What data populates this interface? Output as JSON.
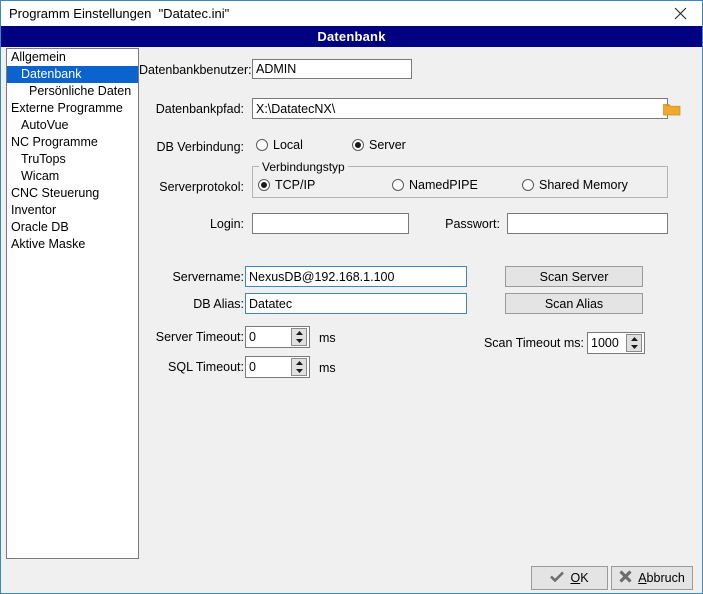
{
  "window": {
    "title": "Programm Einstellungen  \"Datatec.ini\"",
    "close_icon": "close-icon",
    "header_title": "Datenbank",
    "accent_blue": "#000080",
    "selection_blue": "#0b63ce",
    "border_blue": "#3b87c0",
    "folder_icon_color": "#f0a92e"
  },
  "sidebar": {
    "items": [
      {
        "label": "Allgemein",
        "level": 0,
        "selected": false
      },
      {
        "label": "Datenbank",
        "level": 1,
        "selected": true
      },
      {
        "label": "Persönliche Daten",
        "level": 2,
        "selected": false
      },
      {
        "label": "Externe Programme",
        "level": 0,
        "selected": false
      },
      {
        "label": "AutoVue",
        "level": 1,
        "selected": false
      },
      {
        "label": "NC Programme",
        "level": 0,
        "selected": false
      },
      {
        "label": "TruTops",
        "level": 1,
        "selected": false
      },
      {
        "label": "Wicam",
        "level": 1,
        "selected": false
      },
      {
        "label": "CNC Steuerung",
        "level": 0,
        "selected": false
      },
      {
        "label": "Inventor",
        "level": 0,
        "selected": false
      },
      {
        "label": "Oracle DB",
        "level": 0,
        "selected": false
      },
      {
        "label": "Aktive Maske",
        "level": 0,
        "selected": false
      }
    ]
  },
  "form": {
    "db_user_label": "Datenbankbenutzer:",
    "db_user_value": "ADMIN",
    "db_path_label": "Datenbankpfad:",
    "db_path_value": "X:\\DatatecNX\\",
    "db_connection_label": "DB Verbindung:",
    "connection_options": [
      {
        "label": "Local",
        "checked": false
      },
      {
        "label": "Server",
        "checked": true
      }
    ],
    "server_protocol_label": "Serverprotokol:",
    "connection_type_legend": "Verbindungstyp",
    "protocol_options": [
      {
        "label": "TCP/IP",
        "checked": true
      },
      {
        "label": "NamedPIPE",
        "checked": false
      },
      {
        "label": "Shared Memory",
        "checked": false
      }
    ],
    "login_label": "Login:",
    "login_value": "",
    "password_label": "Passwort:",
    "password_value": "",
    "servername_label": "Servername:",
    "servername_value": "NexusDB@192.168.1.100",
    "db_alias_label": "DB Alias:",
    "db_alias_value": "Datatec",
    "server_timeout_label": "Server Timeout:",
    "server_timeout_value": "0",
    "server_timeout_unit": "ms",
    "sql_timeout_label": "SQL Timeout:",
    "sql_timeout_value": "0",
    "sql_timeout_unit": "ms",
    "scan_server_button": "Scan Server",
    "scan_alias_button": "Scan Alias",
    "scan_timeout_label": "Scan Timeout ms:",
    "scan_timeout_value": "1000"
  },
  "footer": {
    "ok_pre": "",
    "ok_acc": "O",
    "ok_post": "K",
    "cancel_pre": "",
    "cancel_acc": "A",
    "cancel_post": "bbruch",
    "ok_icon": "check-icon",
    "cancel_icon": "cross-icon"
  }
}
